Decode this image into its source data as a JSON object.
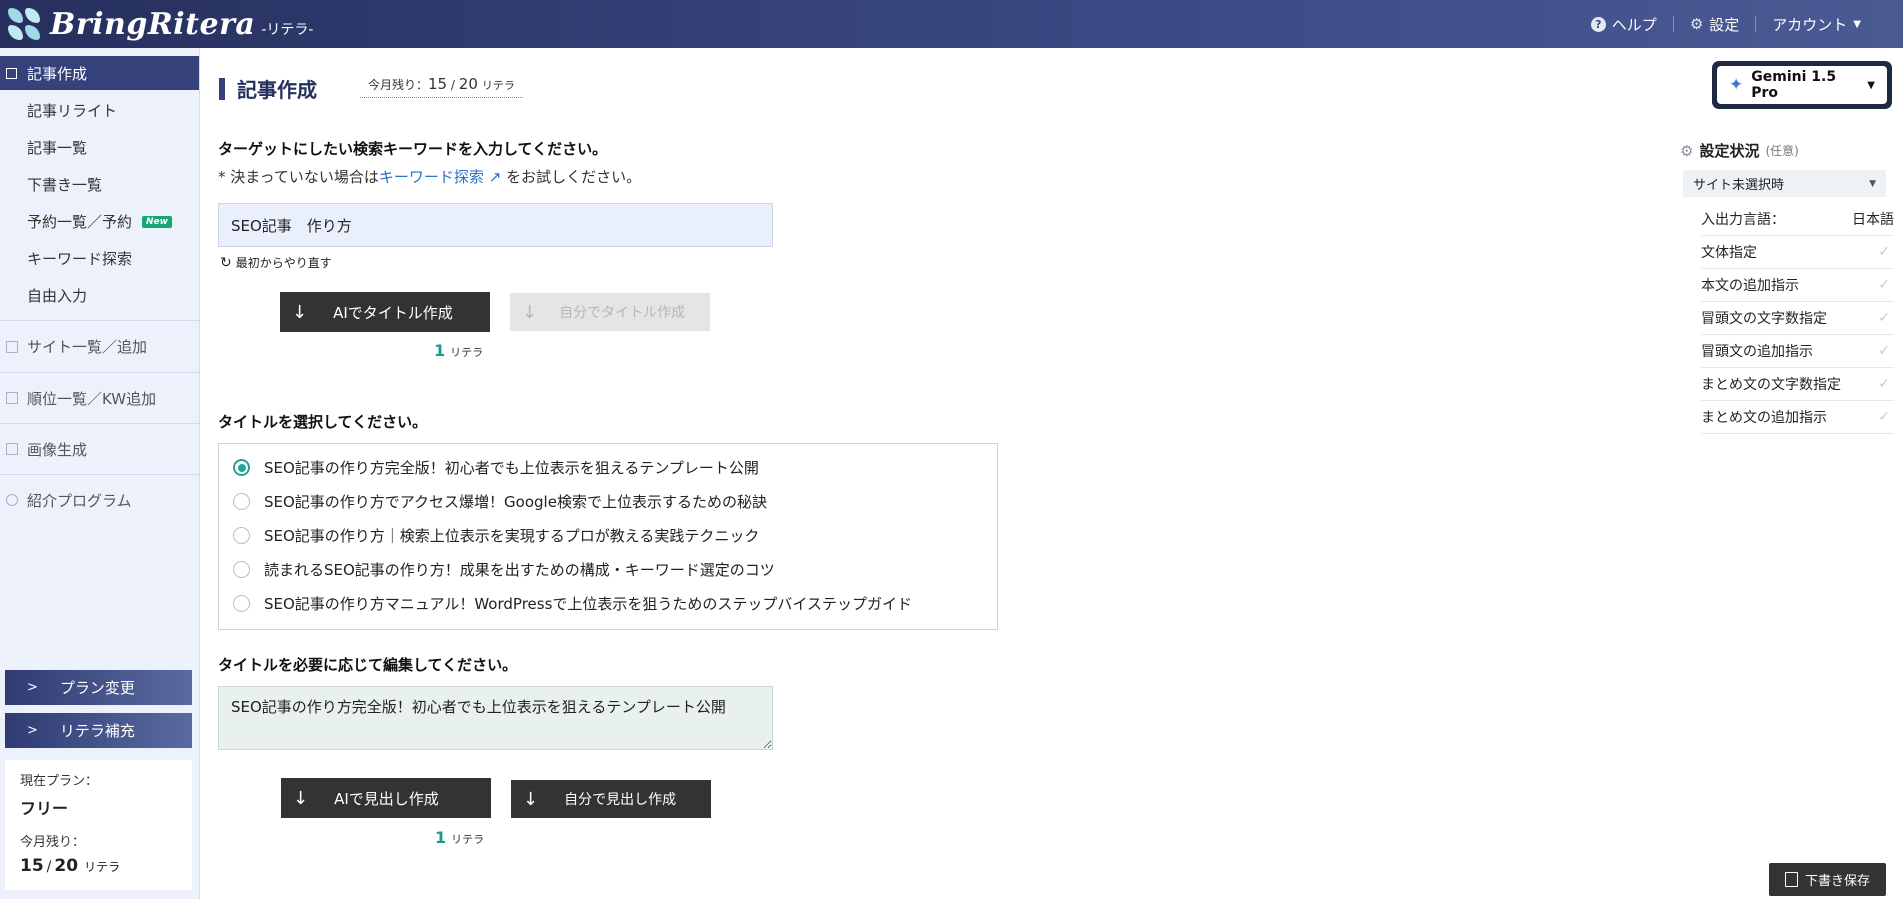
{
  "header": {
    "logo": "BringRitera",
    "logo_sub": "-リテラ-",
    "help": "ヘルプ",
    "settings": "設定",
    "account": "アカウント"
  },
  "sidebar": {
    "active": "記事作成",
    "sub_items": [
      "記事リライト",
      "記事一覧",
      "下書き一覧",
      "予約一覧／予約",
      "キーワード探索",
      "自由入力"
    ],
    "new_badge": "New",
    "groups": [
      "サイト一覧／追加",
      "順位一覧／KW追加",
      "画像生成",
      "紹介プログラム"
    ],
    "plan_change": "プラン変更",
    "ritera_refill": "リテラ補充",
    "plan_label": "現在プラン：",
    "plan_value": "フリー",
    "remain_label": "今月残り：",
    "remain_current": "15",
    "remain_total": "20",
    "remain_unit": "リテラ"
  },
  "main": {
    "title": "記事作成",
    "remain_prefix": "今月残り：",
    "remain_current": "15",
    "remain_total": "20",
    "remain_unit": "リテラ",
    "kw_question": "ターゲットにしたい検索キーワードを入力してください。",
    "kw_note_pre": "* 決まっていない場合は",
    "kw_note_link": "キーワード探索",
    "kw_note_post": "をお試しください。",
    "kw_value": "SEO記事　作り方",
    "restart": "最初からやり直す",
    "ai_title_btn": "AIでタイトル作成",
    "self_title_btn": "自分でタイトル作成",
    "cost_value": "1",
    "cost_unit": "リテラ",
    "select_title_q": "タイトルを選択してください。",
    "title_options": [
      "SEO記事の作り方完全版！初心者でも上位表示を狙えるテンプレート公開",
      "SEO記事の作り方でアクセス爆増！Google検索で上位表示するための秘訣",
      "SEO記事の作り方｜検索上位表示を実現するプロが教える実践テクニック",
      "読まれるSEO記事の作り方！成果を出すための構成・キーワード選定のコツ",
      "SEO記事の作り方マニュアル！WordPressで上位表示を狙うためのステップバイステップガイド"
    ],
    "selected_index": 0,
    "edit_title_q": "タイトルを必要に応じて編集してください。",
    "edit_title_value": "SEO記事の作り方完全版！初心者でも上位表示を狙えるテンプレート公開",
    "ai_heading_btn": "AIで見出し作成",
    "self_heading_btn": "自分で見出し作成",
    "cost2_value": "1",
    "cost2_unit": "リテラ"
  },
  "right": {
    "model": "Gemini 1.5 Pro",
    "settings_title": "設定状況",
    "settings_opt": "(任意)",
    "site_select": "サイト未選択時",
    "io_lang_label": "入出力言語：",
    "io_lang_value": "日本語",
    "rows": [
      "文体指定",
      "本文の追加指示",
      "冒頭文の文字数指定",
      "冒頭文の追加指示",
      "まとめ文の文字数指定",
      "まとめ文の追加指示"
    ],
    "draft_save": "下書き保存"
  }
}
